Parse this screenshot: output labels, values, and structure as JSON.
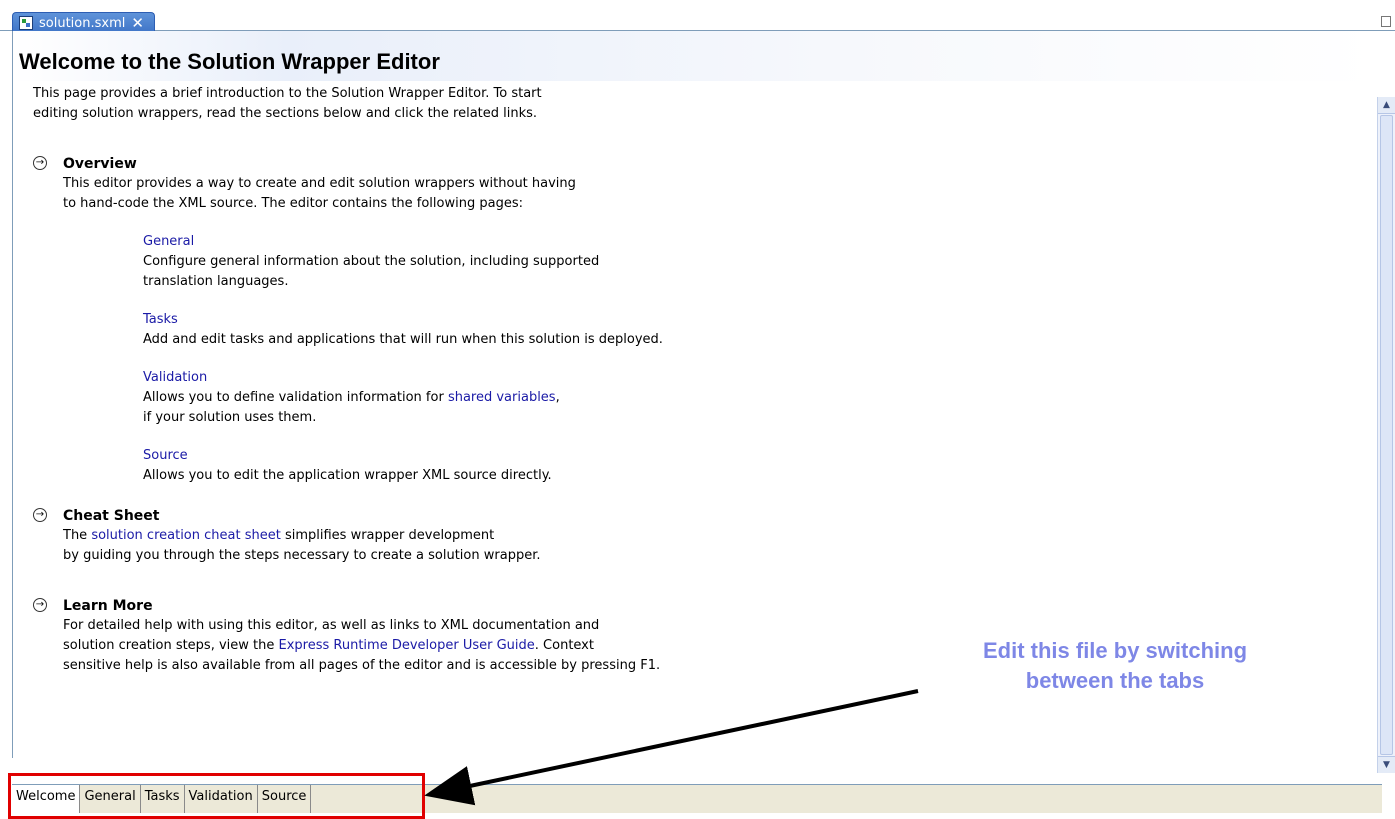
{
  "editor_tab": {
    "label": "solution.sxml",
    "close": "✕"
  },
  "page_title": "Welcome to the Solution Wrapper Editor",
  "intro": {
    "line1": "This page provides a brief introduction to the Solution Wrapper Editor. To start",
    "line2": "editing solution wrappers, read the sections below and click the related links."
  },
  "overview": {
    "title": "Overview",
    "line1": "This editor provides a way to create and edit solution wrappers without having",
    "line2": "to hand-code the XML source. The editor contains the following pages:",
    "pages": [
      {
        "link": "General",
        "line1": "Configure general information about the solution, including supported",
        "line2": "translation languages."
      },
      {
        "link": "Tasks",
        "line1": "Add and edit tasks and applications that will run when this solution is deployed."
      },
      {
        "link": "Validation",
        "line1_before": "Allows you to define validation information for ",
        "line1_link": "shared variables",
        "line1_after": ",",
        "line2": "if your solution uses them."
      },
      {
        "link": "Source",
        "line1": "Allows you to edit the application wrapper XML source directly."
      }
    ]
  },
  "cheat_sheet": {
    "title": "Cheat Sheet",
    "line1_before": "The ",
    "line1_link": "solution creation cheat sheet",
    "line1_after": " simplifies wrapper development",
    "line2": "by guiding you through the steps necessary to create a solution wrapper."
  },
  "learn_more": {
    "title": "Learn More",
    "line1": "For detailed help with using this editor, as well as links to XML documentation and",
    "line2_before": "solution creation steps, view the ",
    "line2_link": "Express Runtime Developer User Guide",
    "line2_after": ". Context",
    "line3": "sensitive help is also available from all pages of the editor and is accessible by pressing F1."
  },
  "page_tabs": [
    "Welcome",
    "General",
    "Tasks",
    "Validation",
    "Source"
  ],
  "callout": {
    "line1": "Edit this file by switching",
    "line2": "between the tabs"
  },
  "colors": {
    "link": "#1a1aa6",
    "callout_text": "#7e87e6",
    "callout_box": "#e00000",
    "tab_active": "#ffffff"
  },
  "icons": {
    "section": "arrow-circle-icon",
    "file": "sxml-file-icon"
  }
}
